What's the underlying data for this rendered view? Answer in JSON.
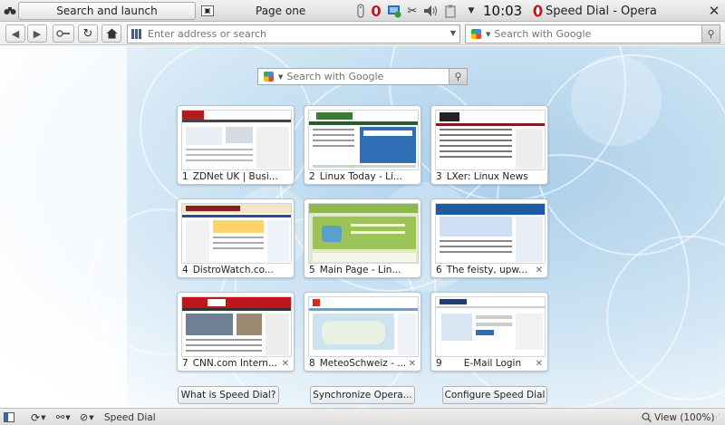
{
  "topbar": {
    "launch_label": "Search and launch",
    "task_label": "Page one",
    "clock": "10:03",
    "window_title": "Speed Dial - Opera"
  },
  "toolbar": {
    "address_placeholder": "Enter address or search",
    "search_placeholder": "Search with Google"
  },
  "speed_dial": {
    "search_placeholder": "Search with Google",
    "tiles": [
      {
        "num": "1",
        "title": "ZDNet UK | Busi..."
      },
      {
        "num": "2",
        "title": "Linux Today - Li..."
      },
      {
        "num": "3",
        "title": "LXer: Linux News"
      },
      {
        "num": "4",
        "title": "DistroWatch.co..."
      },
      {
        "num": "5",
        "title": "Main Page - Lin..."
      },
      {
        "num": "6",
        "title": "The feisty, upw..."
      },
      {
        "num": "7",
        "title": "CNN.com Intern..."
      },
      {
        "num": "8",
        "title": "MeteoSchweiz - ..."
      },
      {
        "num": "9",
        "title": "E-Mail Login"
      }
    ],
    "buttons": {
      "what": "What is Speed Dial?",
      "sync": "Synchronize Opera...",
      "configure": "Configure Speed Dial"
    }
  },
  "status": {
    "label": "Speed Dial",
    "zoom": "View (100%)"
  },
  "colors": {
    "accent_blue": "#3a5e99",
    "opera_red": "#cc0f16",
    "background_blue": "#b9d7ec"
  }
}
